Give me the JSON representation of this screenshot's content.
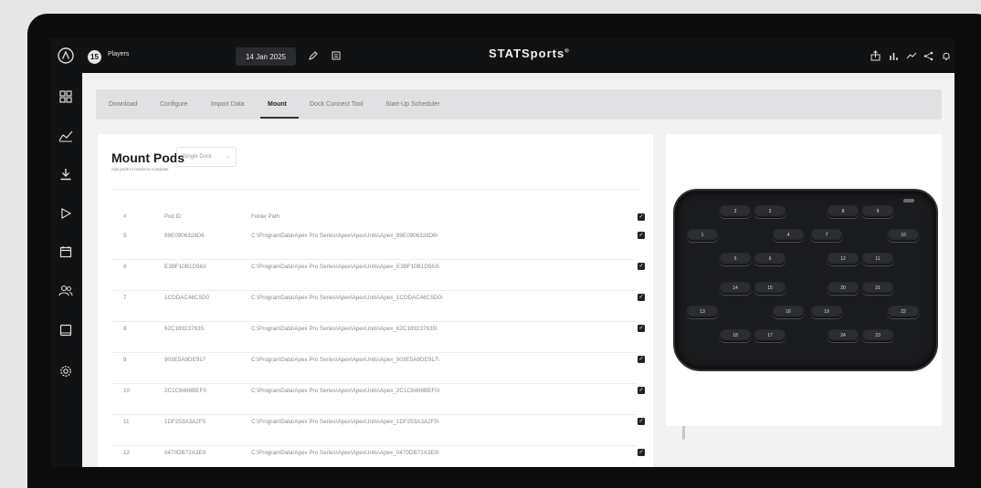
{
  "topbar": {
    "players_count": "15",
    "players_label": "Players",
    "date": "14 Jan 2025",
    "brand": "STATSports",
    "brand_mark": "®"
  },
  "tabs": [
    {
      "label": "Download"
    },
    {
      "label": "Configure"
    },
    {
      "label": "Import Data"
    },
    {
      "label": "Mount",
      "active": true
    },
    {
      "label": "Dock Connect Tool"
    },
    {
      "label": "Start-Up Scheduler"
    }
  ],
  "mount": {
    "title": "Mount Pods",
    "subtitle": "Add pods to mount to computer",
    "mode": "Single Dock"
  },
  "table": {
    "headers": [
      "#",
      "Pod ID",
      "Folder Path"
    ],
    "rows": [
      {
        "n": "5",
        "pod": "89E0906328D6",
        "path": "C:\\ProgramData\\Apex Pro Series\\Apex\\ApexUnits\\Apex_89E0906328D6\\",
        "checked": true
      },
      {
        "n": "6",
        "pod": "E3BF10B1D563",
        "path": "C:\\ProgramData\\Apex Pro Series\\Apex\\ApexUnits\\Apex_E3BF10B1D563\\",
        "checked": true
      },
      {
        "n": "7",
        "pod": "1CDDAC46C5D0",
        "path": "C:\\ProgramData\\Apex Pro Series\\Apex\\ApexUnits\\Apex_1CDDAC46C5D0\\",
        "checked": true
      },
      {
        "n": "8",
        "pod": "62C189237635",
        "path": "C:\\ProgramData\\Apex Pro Series\\Apex\\ApexUnits\\Apex_62C189237635\\",
        "checked": true
      },
      {
        "n": "9",
        "pod": "903E5A9DE917",
        "path": "C:\\ProgramData\\Apex Pro Series\\Apex\\ApexUnits\\Apex_903E5A9DE917\\",
        "checked": true
      },
      {
        "n": "10",
        "pod": "2C1C6468BEF0",
        "path": "C:\\ProgramData\\Apex Pro Series\\Apex\\ApexUnits\\Apex_2C1C6468BEF0\\",
        "checked": true
      },
      {
        "n": "11",
        "pod": "1DF253A3A2F5",
        "path": "C:\\ProgramData\\Apex Pro Series\\Apex\\ApexUnits\\Apex_1DF253A3A2F5\\",
        "checked": true
      },
      {
        "n": "12",
        "pod": "0470DB72A3E9",
        "path": "C:\\ProgramData\\Apex Pro Series\\Apex\\ApexUnits\\Apex_0470DB72A3E9\\",
        "checked": true
      }
    ]
  },
  "dock": {
    "pods": [
      "1",
      "2",
      "3",
      "4",
      "5",
      "6",
      "7",
      "8",
      "9",
      "10",
      "11",
      "12",
      "13",
      "14",
      "15",
      "16",
      "17",
      "18",
      "19",
      "20",
      "21",
      "22",
      "23",
      "24"
    ]
  },
  "icons": {
    "sidebar": [
      "logo-icon",
      "dashboard-icon",
      "analytics-icon",
      "download-icon",
      "play-icon",
      "calendar-icon",
      "players-icon",
      "tablet-icon",
      "settings-icon"
    ],
    "topbar_right": [
      "share-icon",
      "bar-chart-icon",
      "trend-icon",
      "share-nodes-icon",
      "bell-icon",
      "info-icon"
    ]
  }
}
